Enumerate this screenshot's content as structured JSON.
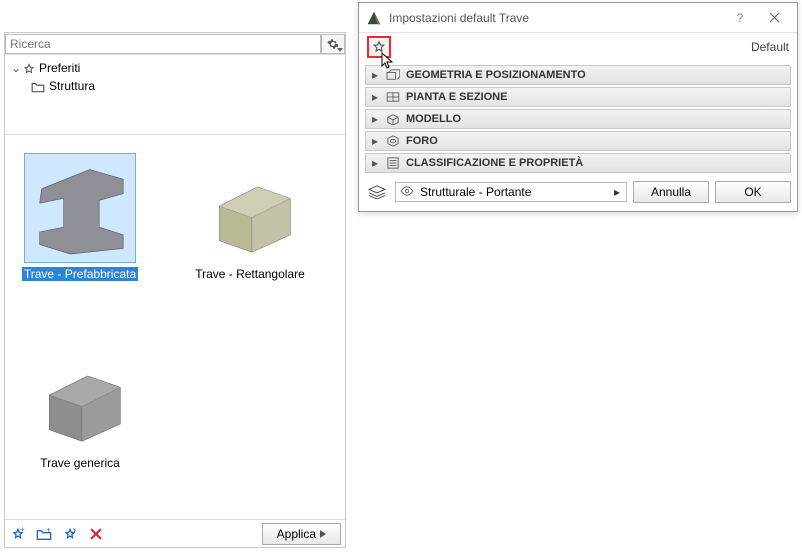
{
  "left": {
    "search_placeholder": "Ricerca",
    "tree": {
      "root": "Preferiti",
      "child": "Struttura"
    },
    "thumbs": [
      {
        "label": "Trave - Prefabbricata"
      },
      {
        "label": "Trave - Rettangolare"
      },
      {
        "label": "Trave generica"
      }
    ],
    "apply": "Applica"
  },
  "dialog": {
    "title": "Impostazioni default Trave",
    "default_label": "Default",
    "sections": [
      "Geometria e Posizionamento",
      "Pianta e Sezione",
      "Modello",
      "Foro",
      "Classificazione e Proprietà"
    ],
    "layer": "Strutturale - Portante",
    "cancel": "Annulla",
    "ok": "OK"
  }
}
